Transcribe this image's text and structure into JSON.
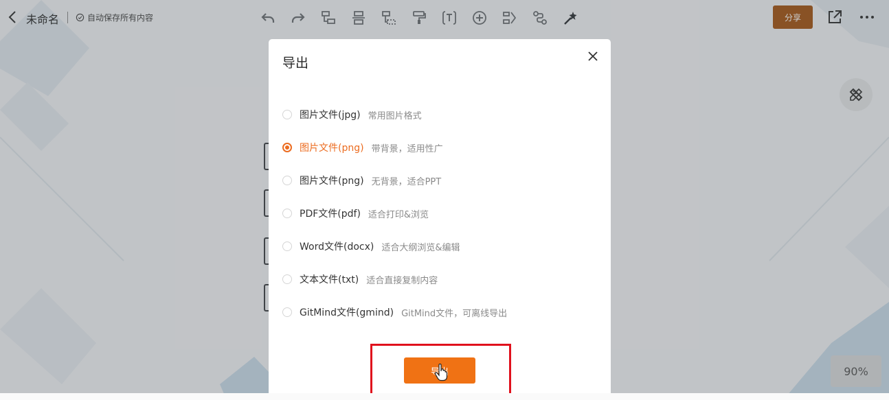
{
  "header": {
    "title": "未命名",
    "save_status": "自动保存所有内容",
    "share_label": "分享"
  },
  "toolbar": {
    "tools": [
      "undo-icon",
      "redo-icon",
      "add-child-node-icon",
      "add-sibling-node-icon",
      "add-parent-node-icon",
      "format-painter-icon",
      "text-icon",
      "insert-icon",
      "summary-icon",
      "relation-line-icon",
      "magic-style-icon"
    ]
  },
  "zoom": "90%",
  "dialog": {
    "title": "导出",
    "options": [
      {
        "label": "图片文件(jpg)",
        "desc": "常用图片格式",
        "checked": false
      },
      {
        "label": "图片文件(png)",
        "desc": "带背景，适用性广",
        "checked": true
      },
      {
        "label": "图片文件(png)",
        "desc": "无背景，适合PPT",
        "checked": false
      },
      {
        "label": "PDF文件(pdf)",
        "desc": "适合打印&浏览",
        "checked": false
      },
      {
        "label": "Word文件(docx)",
        "desc": "适合大纲浏览&编辑",
        "checked": false
      },
      {
        "label": "文本文件(txt)",
        "desc": "适合直接复制内容",
        "checked": false
      },
      {
        "label": "GitMind文件(gmind)",
        "desc": "GitMind文件，可离线导出",
        "checked": false
      }
    ],
    "export_label": "导出"
  },
  "colors": {
    "accent": "#f07214",
    "share_button": "#a45515",
    "highlight_box": "#e0111d"
  }
}
